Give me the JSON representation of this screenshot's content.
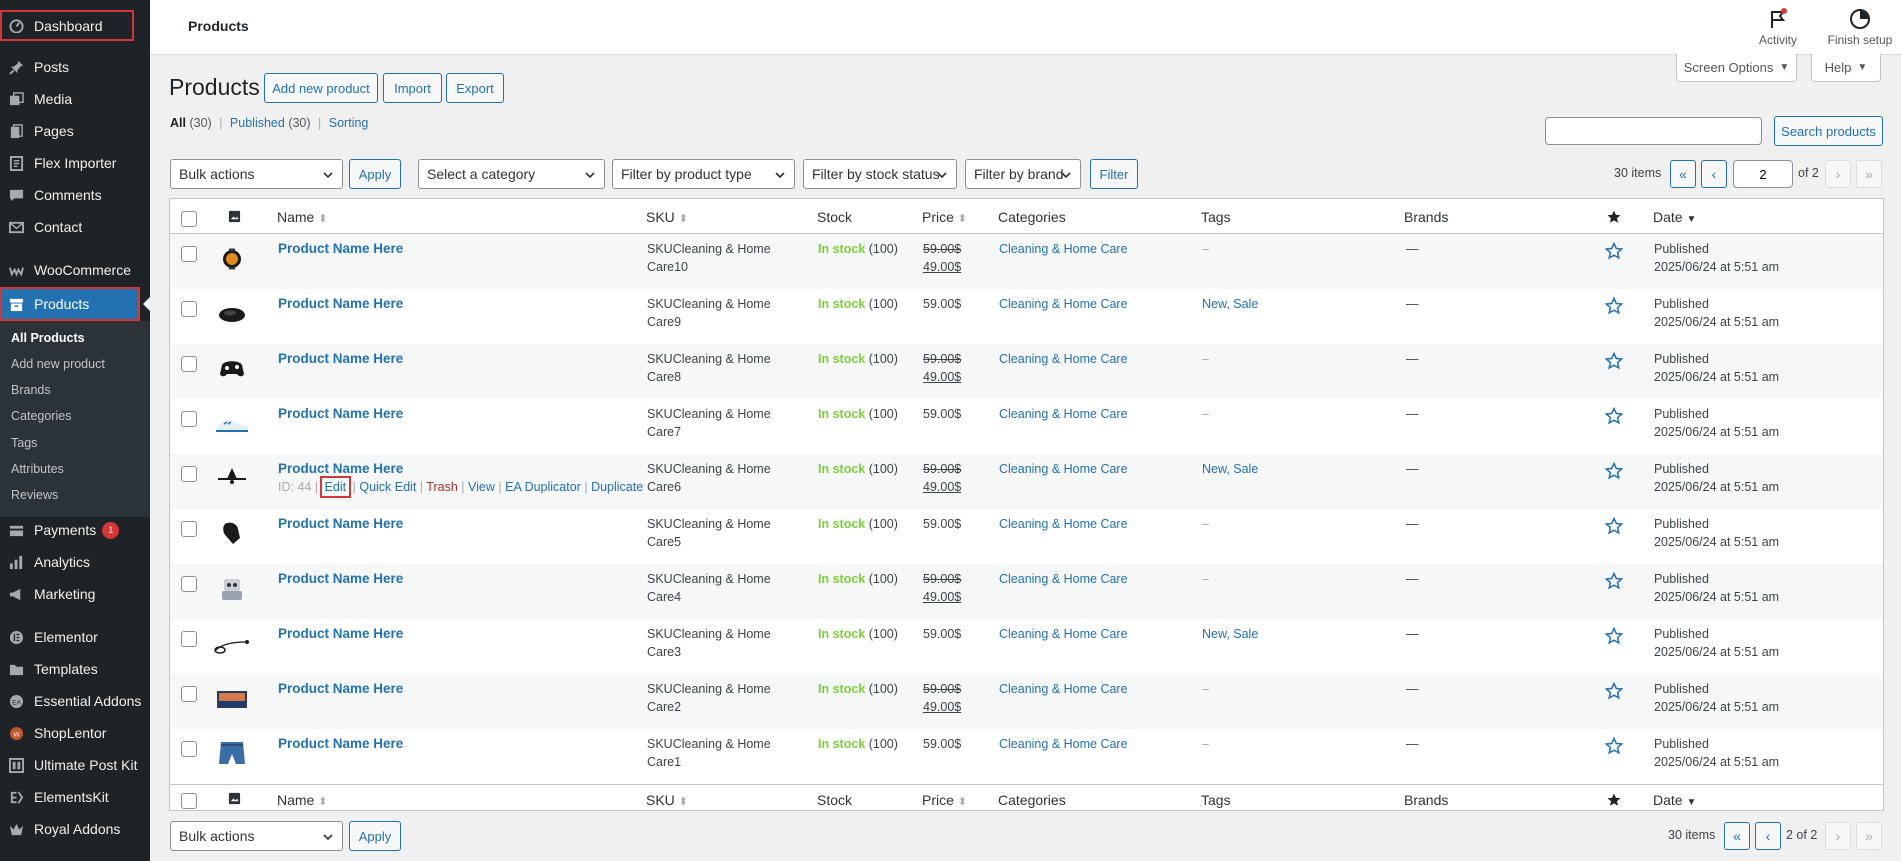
{
  "menu": {
    "dashboard": "Dashboard",
    "posts": "Posts",
    "media": "Media",
    "pages": "Pages",
    "flex_importer": "Flex Importer",
    "comments": "Comments",
    "contact": "Contact",
    "woocommerce": "WooCommerce",
    "products": "Products",
    "payments": "Payments",
    "payments_badge": "1",
    "analytics": "Analytics",
    "marketing": "Marketing",
    "elementor": "Elementor",
    "templates": "Templates",
    "essential_addons": "Essential Addons",
    "shoplentor": "ShopLentor",
    "ultimate_post_kit": "Ultimate Post Kit",
    "elementskit": "ElementsKit",
    "royal_addons": "Royal Addons"
  },
  "submenu": [
    "All Products",
    "Add new product",
    "Brands",
    "Categories",
    "Tags",
    "Attributes",
    "Reviews"
  ],
  "topbar": {
    "title": "Products",
    "activity": "Activity",
    "finish_setup": "Finish setup"
  },
  "screen_options": "Screen Options",
  "help": "Help",
  "page": {
    "title": "Products",
    "add_new": "Add new product",
    "import": "Import",
    "export": "Export"
  },
  "views": {
    "all": "All",
    "all_count": "(30)",
    "published": "Published",
    "published_count": "(30)",
    "sorting": "Sorting",
    "sep": "|"
  },
  "search": {
    "value": "",
    "button": "Search products"
  },
  "filters": {
    "bulk_actions": "Bulk actions",
    "apply": "Apply",
    "category": "Select a category",
    "product_type": "Filter by product type",
    "stock_status": "Filter by stock status",
    "brand": "Filter by brand",
    "filter": "Filter"
  },
  "pagination": {
    "items": "30 items",
    "current_page": "2",
    "of_total": "of 2",
    "bottom_label": "2 of 2",
    "first": "«",
    "prev": "‹",
    "next": "›",
    "last": "»"
  },
  "columns": {
    "name": "Name",
    "sku": "SKU",
    "stock": "Stock",
    "price": "Price",
    "categories": "Categories",
    "tags": "Tags",
    "brands": "Brands",
    "date": "Date"
  },
  "hover_actions": {
    "id": "ID: 44",
    "edit": "Edit",
    "quick_edit": "Quick Edit",
    "trash": "Trash",
    "view": "View",
    "ea_duplicator": "EA Duplicator",
    "duplicate": "Duplicate",
    "sep": "|"
  },
  "products": [
    {
      "name": "Product Name Here",
      "sku1": "SKUCleaning & Home",
      "sku2": "Care10",
      "stock": "In stock",
      "qty": "(100)",
      "price": "59.00$",
      "sale": "49.00$",
      "category": "Cleaning & Home Care",
      "tags": "–",
      "brands": "—",
      "status": "Published",
      "date": "2025/06/24 at 5:51 am",
      "thumb": "watch-icon"
    },
    {
      "name": "Product Name Here",
      "sku1": "SKUCleaning & Home",
      "sku2": "Care9",
      "stock": "In stock",
      "qty": "(100)",
      "price": "59.00$",
      "sale": "",
      "category": "Cleaning & Home Care",
      "tags": "New, Sale",
      "brands": "—",
      "status": "Published",
      "date": "2025/06/24 at 5:51 am",
      "thumb": "mouse-icon"
    },
    {
      "name": "Product Name Here",
      "sku1": "SKUCleaning & Home",
      "sku2": "Care8",
      "stock": "In stock",
      "qty": "(100)",
      "price": "59.00$",
      "sale": "49.00$",
      "category": "Cleaning & Home Care",
      "tags": "–",
      "brands": "—",
      "status": "Published",
      "date": "2025/06/24 at 5:51 am",
      "thumb": "gamepad-icon"
    },
    {
      "name": "Product Name Here",
      "sku1": "SKUCleaning & Home",
      "sku2": "Care7",
      "stock": "In stock",
      "qty": "(100)",
      "price": "59.00$",
      "sale": "",
      "category": "Cleaning & Home Care",
      "tags": "–",
      "brands": "—",
      "status": "Published",
      "date": "2025/06/24 at 5:51 am",
      "thumb": "sneaker-icon"
    },
    {
      "name": "Product Name Here",
      "sku1": "SKUCleaning & Home",
      "sku2": "Care6",
      "stock": "In stock",
      "qty": "(100)",
      "price": "59.00$",
      "sale": "49.00$",
      "category": "Cleaning & Home Care",
      "tags": "New, Sale",
      "brands": "—",
      "status": "Published",
      "date": "2025/06/24 at 5:51 am",
      "thumb": "drone-icon"
    },
    {
      "name": "Product Name Here",
      "sku1": "SKUCleaning & Home",
      "sku2": "Care5",
      "stock": "In stock",
      "qty": "(100)",
      "price": "59.00$",
      "sale": "",
      "category": "Cleaning & Home Care",
      "tags": "–",
      "brands": "—",
      "status": "Published",
      "date": "2025/06/24 at 5:51 am",
      "thumb": "glove-icon"
    },
    {
      "name": "Product Name Here",
      "sku1": "SKUCleaning & Home",
      "sku2": "Care4",
      "stock": "In stock",
      "qty": "(100)",
      "price": "59.00$",
      "sale": "49.00$",
      "category": "Cleaning & Home Care",
      "tags": "–",
      "brands": "—",
      "status": "Published",
      "date": "2025/06/24 at 5:51 am",
      "thumb": "robot-icon"
    },
    {
      "name": "Product Name Here",
      "sku1": "SKUCleaning & Home",
      "sku2": "Care3",
      "stock": "In stock",
      "qty": "(100)",
      "price": "59.00$",
      "sale": "",
      "category": "Cleaning & Home Care",
      "tags": "New, Sale",
      "brands": "—",
      "status": "Published",
      "date": "2025/06/24 at 5:51 am",
      "thumb": "earphones-icon"
    },
    {
      "name": "Product Name Here",
      "sku1": "SKUCleaning & Home",
      "sku2": "Care2",
      "stock": "In stock",
      "qty": "(100)",
      "price": "59.00$",
      "sale": "49.00$",
      "category": "Cleaning & Home Care",
      "tags": "–",
      "brands": "—",
      "status": "Published",
      "date": "2025/06/24 at 5:51 am",
      "thumb": "tv-icon"
    },
    {
      "name": "Product Name Here",
      "sku1": "SKUCleaning & Home",
      "sku2": "Care1",
      "stock": "In stock",
      "qty": "(100)",
      "price": "59.00$",
      "sale": "",
      "category": "Cleaning & Home Care",
      "tags": "–",
      "brands": "—",
      "status": "Published",
      "date": "2025/06/24 at 5:51 am",
      "thumb": "shorts-icon"
    }
  ],
  "colors": {
    "sidebar": "#1d2327",
    "accent": "#2271b1",
    "in_stock": "#7ad03a",
    "highlight": "#d63638"
  }
}
